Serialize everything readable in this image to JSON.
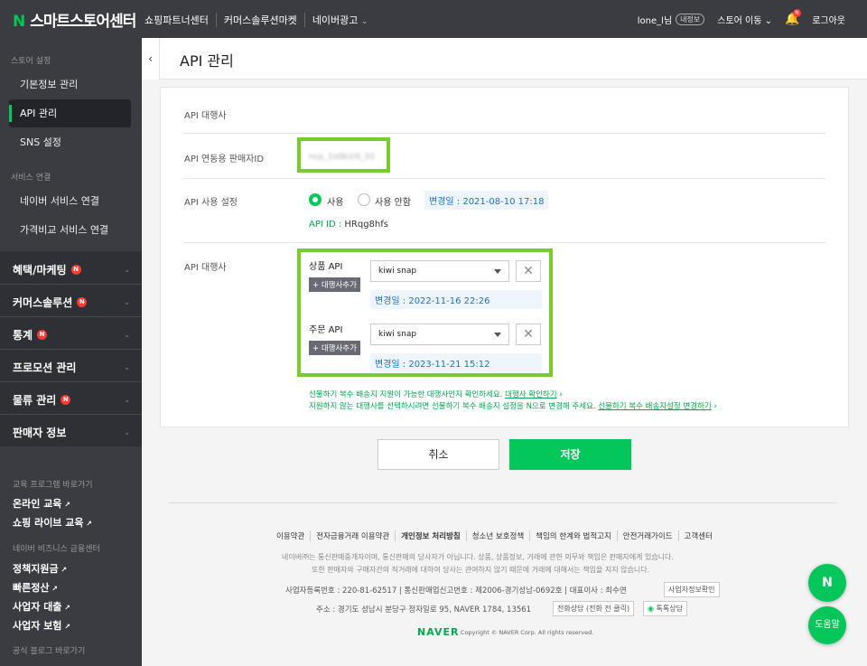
{
  "header": {
    "logo_n": "N",
    "logo_text": "스마트스토어센터",
    "nav": [
      "쇼핑파트너센터",
      "커머스솔루션마켓",
      "네이버광고"
    ],
    "nav_chevron": "⌄",
    "user": "lone_l님",
    "my_info": "내정보",
    "store_move": "스토어 이동 ⌄",
    "notification_badge": "N",
    "logout": "로그아웃"
  },
  "sidebar": {
    "section_store": "스토어 설정",
    "items_store": [
      "기본정보 관리",
      "API 관리",
      "SNS 설정"
    ],
    "section_service": "서비스 연결",
    "items_service": [
      "네이버 서비스 연결",
      "가격비교 서비스 연결"
    ],
    "main_menus": [
      {
        "label": "혜택/마케팅",
        "badge": "N"
      },
      {
        "label": "커머스솔루션",
        "badge": "N"
      },
      {
        "label": "통계",
        "badge": "N"
      },
      {
        "label": "프로모션 관리",
        "badge": ""
      },
      {
        "label": "물류 관리",
        "badge": "N"
      },
      {
        "label": "판매자 정보",
        "badge": ""
      }
    ],
    "section_edu": "교육 프로그램 바로가기",
    "edu_links": [
      "온라인 교육",
      "쇼핑 라이브 교육"
    ],
    "section_finance": "네이버 비즈니스 금융센터",
    "finance_links": [
      "정책지원금",
      "빠른정산",
      "사업자 대출",
      "사업자 보험"
    ],
    "section_blog": "공식 블로그 바로가기"
  },
  "page": {
    "collapse_icon": "‹",
    "title": "API 관리"
  },
  "form": {
    "label_agency": "API 대행사",
    "label_seller_id": "API 연동용 판매자ID",
    "seller_id_value": "ncp_1o0b1iS_01",
    "label_usage": "API 사용 설정",
    "radio_use": "사용",
    "radio_not_use": "사용 안함",
    "usage_changed": "변경일 : 2021-08-10 17:18",
    "api_id_label": "API ID : ",
    "api_id_value": "HRqg8hfs",
    "label_agency2": "API 대행사",
    "product_api": "상품 API",
    "order_api": "주문 API",
    "add_agency": "+ 대행사추가",
    "product_select": "kiwi snap",
    "order_select": "kiwi snap",
    "product_changed": "변경일 : 2022-11-16 22:26",
    "order_changed": "변경일 : 2023-11-21 15:12",
    "note1": "선물하기 복수 배송지 지원이 가능한 대행사인지 확인하세요.",
    "note1_link": "대행사 확인하기",
    "note2": "지원하지 않는 대행사를 선택하시려면 선물하기 복수 배송지 설정을 N으로 변경해 주세요.",
    "note2_link": "선물하기 복수 배송지설정 변경하기",
    "note_arrow": "›"
  },
  "actions": {
    "cancel": "취소",
    "save": "저장"
  },
  "footer": {
    "links": [
      "이용약관",
      "전자금융거래 이용약관",
      "개인정보 처리방침",
      "청소년 보호정책",
      "책임의 한계와 법적고지",
      "안전거래가이드",
      "고객센터"
    ],
    "notice1": "네이버㈜는 통신판매중개자이며, 통신판매의 당사자가 아닙니다. 상품, 상품정보, 거래에 관한 의무와 책임은 판매자에게 있습니다.",
    "notice2": "또한 판매자와 구매자간의 직거래에 대하여 당사는 관여하지 않기 때문에 거래에 대해서는 책임을 지지 않습니다.",
    "biz_info": "사업자등록번호 : 220-81-62517  |  통신판매업신고번호 : 제2006-경기성남-0692호  |  대표이사 : 최수연",
    "biz_check": "사업자정보확인",
    "address": "주소 : 경기도 성남시 분당구 정자일로 95, NAVER 1784, 13561",
    "phone_chip": "전화상담 (전화 전 클릭)",
    "talk_chip": "톡톡상담",
    "naver": "NAVER",
    "copyright": "Copyright © NAVER Corp. All rights reserved."
  },
  "fab": {
    "chat_icon": "N",
    "help": "도움말"
  }
}
